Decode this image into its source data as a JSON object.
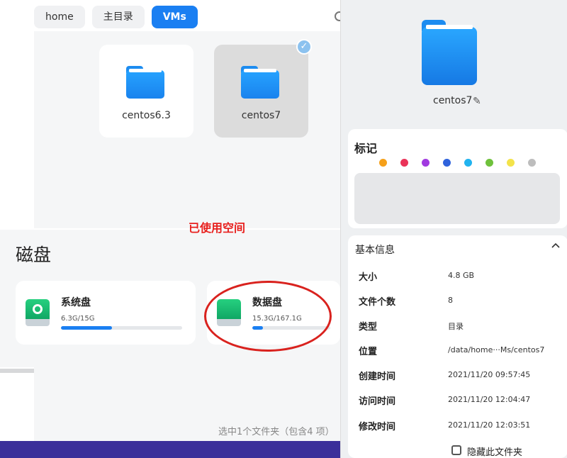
{
  "breadcrumbs": [
    {
      "label": "home"
    },
    {
      "label": "主目录"
    },
    {
      "label": "VMs"
    }
  ],
  "files": [
    {
      "name": "centos6.3"
    },
    {
      "name": "centos7"
    }
  ],
  "annotation": {
    "used_space": "已使用空间"
  },
  "disks": {
    "title": "磁盘",
    "items": [
      {
        "name": "系统盘",
        "usage": "6.3G/15G",
        "fraction": 0.42
      },
      {
        "name": "数据盘",
        "usage": "15.3G/167.1G",
        "fraction": 0.14
      }
    ]
  },
  "status": "选中1个文件夹（包含4 项）",
  "detail": {
    "name": "centos7",
    "tags_title": "标记",
    "tag_colors": [
      "#f5a01a",
      "#ea3358",
      "#a13ae0",
      "#2f63dc",
      "#21b3ef",
      "#6fc13c",
      "#f3e34a",
      "#bdbdbd"
    ],
    "info_title": "基本信息",
    "info": [
      {
        "label": "大小",
        "value": "4.8 GB"
      },
      {
        "label": "文件个数",
        "value": "8"
      },
      {
        "label": "类型",
        "value": "目录"
      },
      {
        "label": "位置",
        "value": "/data/home···Ms/centos7"
      },
      {
        "label": "创建时间",
        "value": "2021/11/20 09:57:45"
      },
      {
        "label": "访问时间",
        "value": "2021/11/20 12:04:47"
      },
      {
        "label": "修改时间",
        "value": "2021/11/20 12:03:51"
      }
    ],
    "hide_label": "隐藏此文件夹"
  }
}
